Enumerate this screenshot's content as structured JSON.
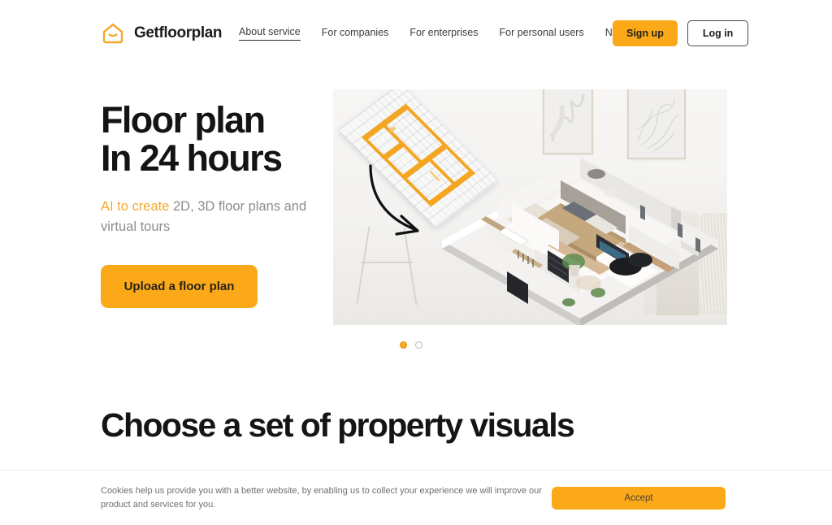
{
  "brand": {
    "name": "Getfloorplan",
    "logo_icon": "home-icon",
    "accent_color": "#FBA919"
  },
  "nav": {
    "items": [
      {
        "label": "About service",
        "active": true
      },
      {
        "label": "For companies",
        "active": false
      },
      {
        "label": "For enterprises",
        "active": false
      },
      {
        "label": "For personal users",
        "active": false
      },
      {
        "label": "News",
        "active": false
      }
    ],
    "signup_label": "Sign up",
    "login_label": "Log in"
  },
  "hero": {
    "title": "Floor plan\nIn 24 hours",
    "subtitle_accent": "AI to create",
    "subtitle_rest": " 2D, 3D floor plans and virtual tours",
    "cta_label": "Upload a floor plan",
    "carousel": {
      "total": 2,
      "active_index": 0
    }
  },
  "section": {
    "heading": "Choose a set of property visuals"
  },
  "cookie": {
    "message": "Cookies help us provide you with a better website, by enabling us to collect your experience we will improve our product and services for you.",
    "accept_label": "Accept"
  }
}
